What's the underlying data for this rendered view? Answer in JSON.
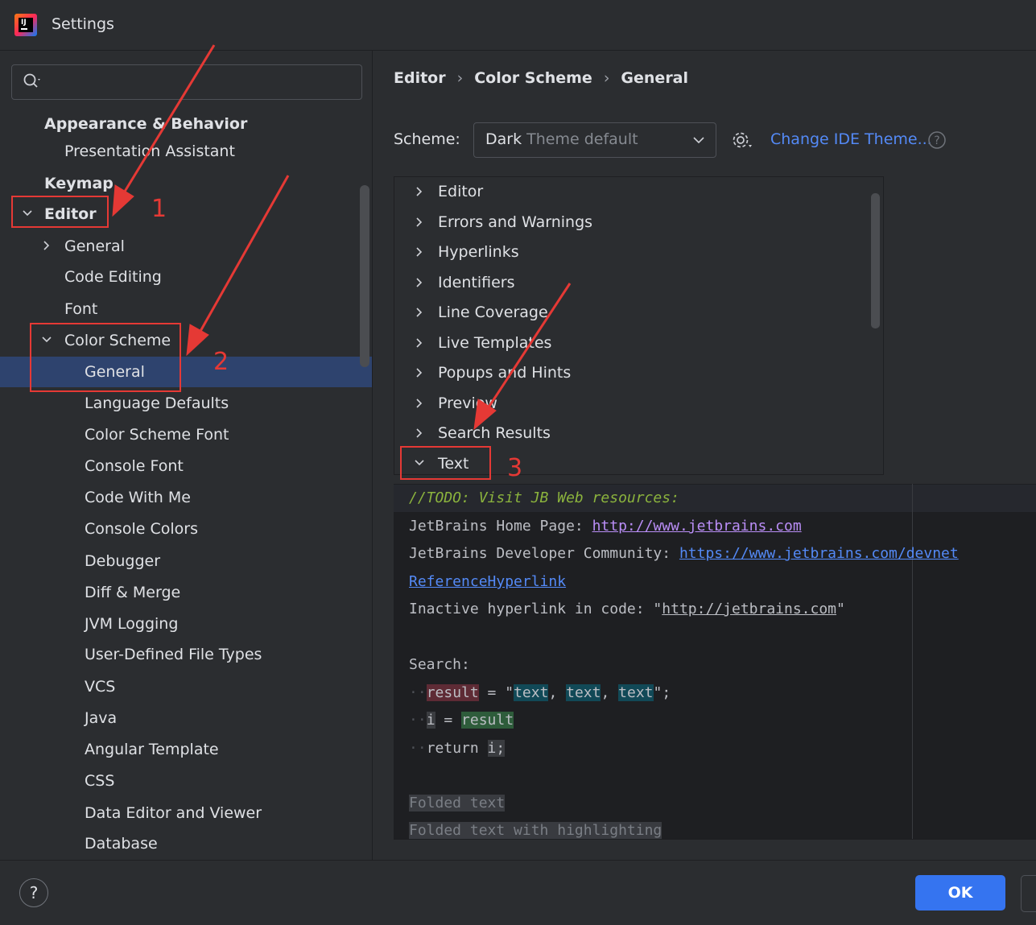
{
  "window": {
    "title": "Settings"
  },
  "sidebar": {
    "search_placeholder": "",
    "items": [
      {
        "label": "Appearance & Behavior",
        "bold": true
      },
      {
        "label": "Presentation Assistant"
      },
      {
        "label": "Keymap",
        "bold": true
      },
      {
        "label": "Editor",
        "bold": true,
        "expanded": true
      },
      {
        "label": "General",
        "collapsed": true
      },
      {
        "label": "Code Editing"
      },
      {
        "label": "Font"
      },
      {
        "label": "Color Scheme",
        "expanded": true
      },
      {
        "label": "General",
        "selected": true
      },
      {
        "label": "Language Defaults"
      },
      {
        "label": "Color Scheme Font"
      },
      {
        "label": "Console Font"
      },
      {
        "label": "Code With Me"
      },
      {
        "label": "Console Colors"
      },
      {
        "label": "Debugger"
      },
      {
        "label": "Diff & Merge"
      },
      {
        "label": "JVM Logging"
      },
      {
        "label": "User-Defined File Types"
      },
      {
        "label": "VCS"
      },
      {
        "label": "Java"
      },
      {
        "label": "Angular Template"
      },
      {
        "label": "CSS"
      },
      {
        "label": "Data Editor and Viewer"
      },
      {
        "label": "Database"
      }
    ]
  },
  "breadcrumb": [
    "Editor",
    "Color Scheme",
    "General"
  ],
  "scheme": {
    "label": "Scheme:",
    "value_main": "Dark",
    "value_dim": " Theme default",
    "change_theme_link": "Change IDE Theme..."
  },
  "categories": [
    {
      "label": "Editor"
    },
    {
      "label": "Errors and Warnings"
    },
    {
      "label": "Hyperlinks"
    },
    {
      "label": "Identifiers"
    },
    {
      "label": "Line Coverage"
    },
    {
      "label": "Live Templates"
    },
    {
      "label": "Popups and Hints"
    },
    {
      "label": "Preview"
    },
    {
      "label": "Search Results"
    },
    {
      "label": "Text",
      "expanded": true
    }
  ],
  "preview": {
    "todo": "//TODO: Visit JB Web resources:",
    "home_label": "JetBrains Home Page: ",
    "home_url": "http://www.jetbrains.com",
    "dev_label": "JetBrains Developer Community: ",
    "dev_url": "https://www.jetbrains.com/devnet",
    "ref_link": "ReferenceHyperlink",
    "inactive_label": "Inactive hyperlink in code: \"",
    "inactive_url": "http://jetbrains.com",
    "inactive_end": "\"",
    "search_label": "Search:",
    "result_var": "result",
    "eq_quote": " = \"",
    "text_word": "text",
    "comma": ", ",
    "close_semicolon": "\";",
    "i_var": "i",
    "eq": " = ",
    "return_kw": "return ",
    "i_semicolon": "i;",
    "folded_text": "Folded text",
    "folded_highlight": "Folded text with highlighting"
  },
  "annotations": [
    "1",
    "2",
    "3"
  ],
  "buttons": {
    "help": "?",
    "ok": "OK"
  },
  "colors": {
    "accent": "#3574f0",
    "selection": "#2e436e",
    "annotation_red": "#e53935",
    "link": "#548af7"
  }
}
